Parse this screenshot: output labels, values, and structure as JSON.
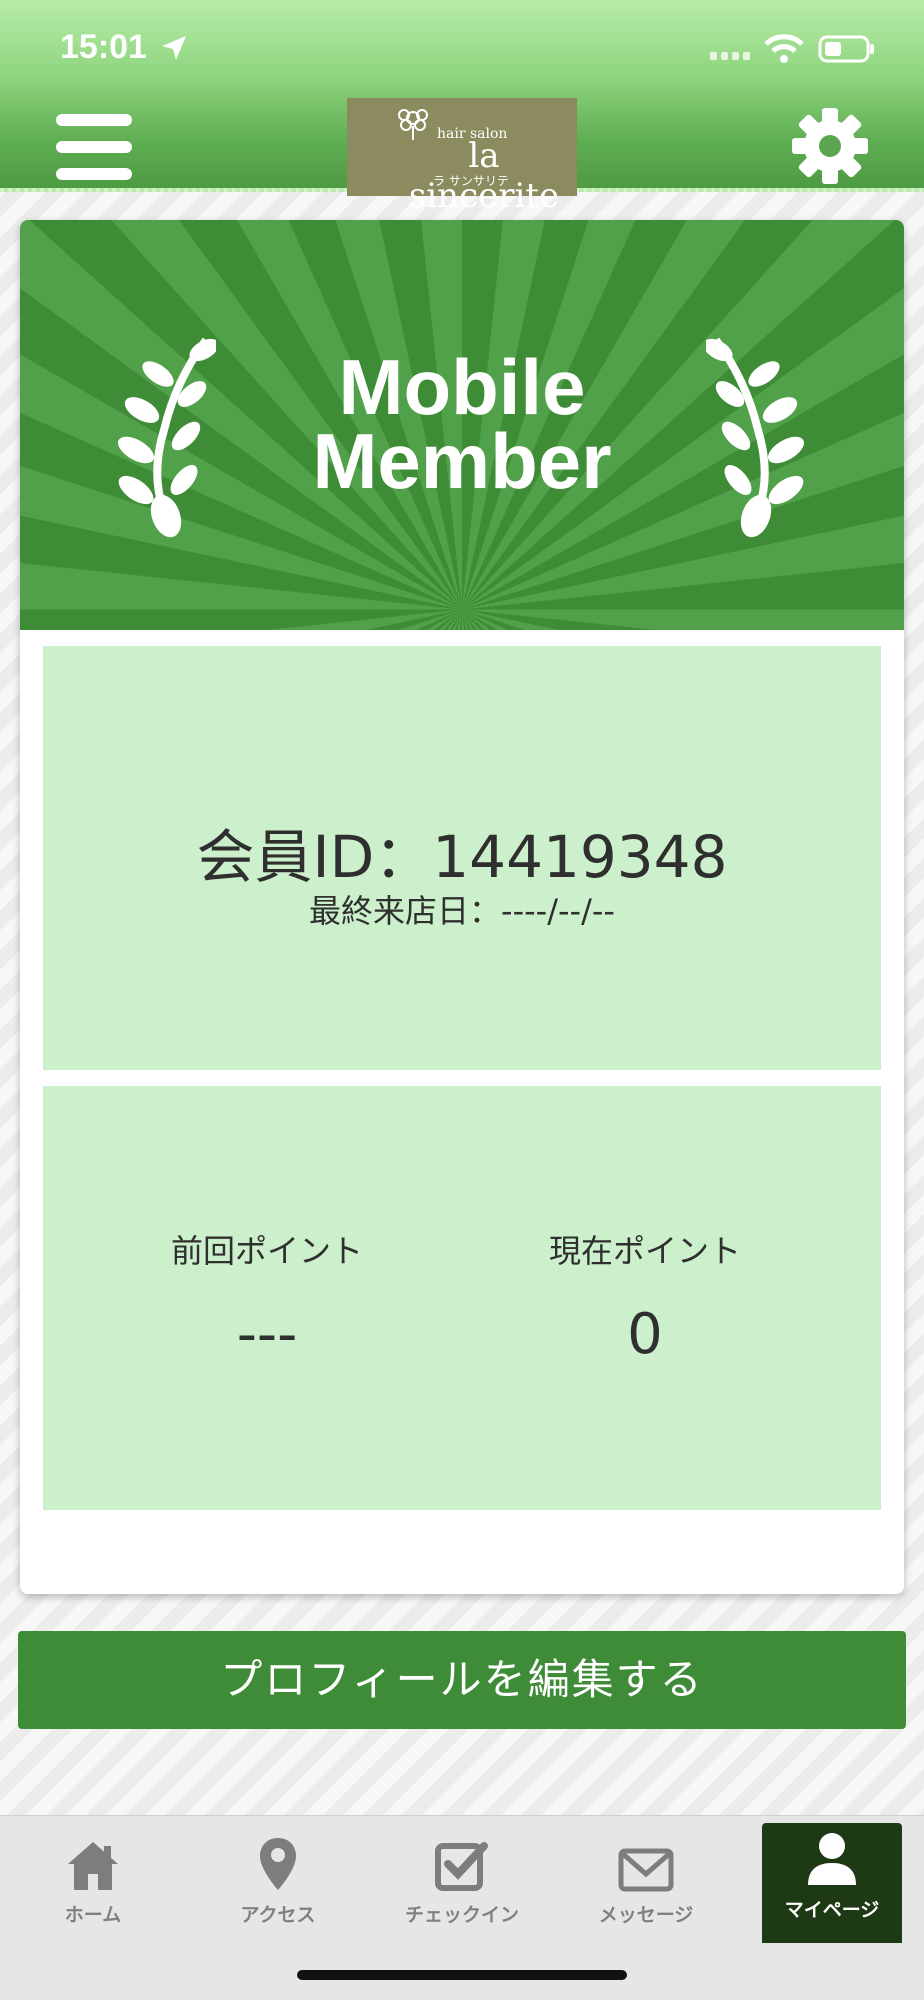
{
  "status_bar": {
    "time": "15:01"
  },
  "header": {
    "logo": {
      "small": "hair salon",
      "main": "la sincerite",
      "kana": "ラ サンサリテ"
    }
  },
  "card": {
    "banner_line1": "Mobile",
    "banner_line2": "Member",
    "member_id": "会員ID：14419348",
    "last_visit": "最終来店日：----/--/--",
    "points": {
      "previous_label": "前回ポイント",
      "previous_value": "---",
      "current_label": "現在ポイント",
      "current_value": "0"
    }
  },
  "edit_profile_label": "プロフィールを編集する",
  "tabs": [
    {
      "label": "ホーム",
      "icon": "home-icon"
    },
    {
      "label": "アクセス",
      "icon": "map-pin-icon"
    },
    {
      "label": "チェックイン",
      "icon": "checkbox-icon"
    },
    {
      "label": "メッセージ",
      "icon": "envelope-icon"
    },
    {
      "label": "マイページ",
      "icon": "person-icon",
      "active": true
    }
  ],
  "colors": {
    "brand_green": "#3f8c38",
    "panel_green": "#ccf0cb",
    "active_tab": "#1e3a14"
  }
}
